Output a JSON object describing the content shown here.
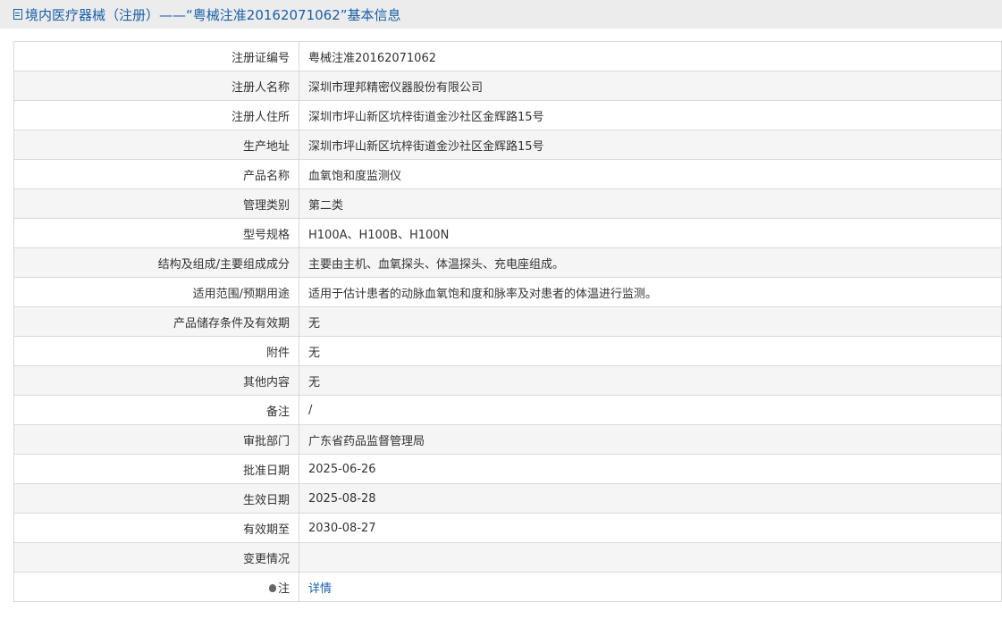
{
  "header": {
    "title": "境内医疗器械（注册）——“粤械注准20162071062”基本信息"
  },
  "rows": [
    {
      "label": "注册证编号",
      "value": "粤械注准20162071062"
    },
    {
      "label": "注册人名称",
      "value": "深圳市理邦精密仪器股份有限公司"
    },
    {
      "label": "注册人住所",
      "value": "深圳市坪山新区坑梓街道金沙社区金辉路15号"
    },
    {
      "label": "生产地址",
      "value": "深圳市坪山新区坑梓街道金沙社区金辉路15号"
    },
    {
      "label": "产品名称",
      "value": "血氧饱和度监测仪"
    },
    {
      "label": "管理类别",
      "value": "第二类"
    },
    {
      "label": "型号规格",
      "value": "H100A、H100B、H100N"
    },
    {
      "label": "结构及组成/主要组成成分",
      "value": "主要由主机、血氧探头、体温探头、充电座组成。"
    },
    {
      "label": "适用范围/预期用途",
      "value": "适用于估计患者的动脉血氧饱和度和脉率及对患者的体温进行监测。"
    },
    {
      "label": "产品储存条件及有效期",
      "value": "无"
    },
    {
      "label": "附件",
      "value": "无"
    },
    {
      "label": "其他内容",
      "value": "无"
    },
    {
      "label": "备注",
      "value": "/"
    },
    {
      "label": "审批部门",
      "value": "广东省药品监督管理局"
    },
    {
      "label": "批准日期",
      "value": "2025-06-26"
    },
    {
      "label": "生效日期",
      "value": "2025-08-28"
    },
    {
      "label": "有效期至",
      "value": "2030-08-27"
    },
    {
      "label": "变更情况",
      "value": ""
    }
  ],
  "note_row": {
    "label": "注",
    "link": "详情",
    "icon": "tip-bulb-icon"
  }
}
